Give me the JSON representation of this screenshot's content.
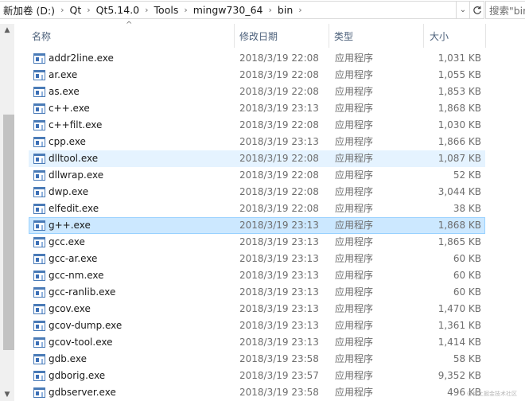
{
  "address": {
    "crumbs": [
      "新加卷 (D:)",
      "Qt",
      "Qt5.14.0",
      "Tools",
      "mingw730_64",
      "bin"
    ],
    "search_placeholder": "搜索\"bin\""
  },
  "columns": {
    "name": "名称",
    "date": "修改日期",
    "type": "类型",
    "size": "大小"
  },
  "files": [
    {
      "name": "addr2line.exe",
      "date": "2018/3/19 22:08",
      "type": "应用程序",
      "size": "1,031 KB"
    },
    {
      "name": "ar.exe",
      "date": "2018/3/19 22:08",
      "type": "应用程序",
      "size": "1,055 KB"
    },
    {
      "name": "as.exe",
      "date": "2018/3/19 22:08",
      "type": "应用程序",
      "size": "1,853 KB"
    },
    {
      "name": "c++.exe",
      "date": "2018/3/19 23:13",
      "type": "应用程序",
      "size": "1,868 KB"
    },
    {
      "name": "c++filt.exe",
      "date": "2018/3/19 22:08",
      "type": "应用程序",
      "size": "1,030 KB"
    },
    {
      "name": "cpp.exe",
      "date": "2018/3/19 23:13",
      "type": "应用程序",
      "size": "1,866 KB"
    },
    {
      "name": "dlltool.exe",
      "date": "2018/3/19 22:08",
      "type": "应用程序",
      "size": "1,087 KB"
    },
    {
      "name": "dllwrap.exe",
      "date": "2018/3/19 22:08",
      "type": "应用程序",
      "size": "52 KB"
    },
    {
      "name": "dwp.exe",
      "date": "2018/3/19 22:08",
      "type": "应用程序",
      "size": "3,044 KB"
    },
    {
      "name": "elfedit.exe",
      "date": "2018/3/19 22:08",
      "type": "应用程序",
      "size": "38 KB"
    },
    {
      "name": "g++.exe",
      "date": "2018/3/19 23:13",
      "type": "应用程序",
      "size": "1,868 KB"
    },
    {
      "name": "gcc.exe",
      "date": "2018/3/19 23:13",
      "type": "应用程序",
      "size": "1,865 KB"
    },
    {
      "name": "gcc-ar.exe",
      "date": "2018/3/19 23:13",
      "type": "应用程序",
      "size": "60 KB"
    },
    {
      "name": "gcc-nm.exe",
      "date": "2018/3/19 23:13",
      "type": "应用程序",
      "size": "60 KB"
    },
    {
      "name": "gcc-ranlib.exe",
      "date": "2018/3/19 23:13",
      "type": "应用程序",
      "size": "60 KB"
    },
    {
      "name": "gcov.exe",
      "date": "2018/3/19 23:13",
      "type": "应用程序",
      "size": "1,470 KB"
    },
    {
      "name": "gcov-dump.exe",
      "date": "2018/3/19 23:13",
      "type": "应用程序",
      "size": "1,361 KB"
    },
    {
      "name": "gcov-tool.exe",
      "date": "2018/3/19 23:13",
      "type": "应用程序",
      "size": "1,414 KB"
    },
    {
      "name": "gdb.exe",
      "date": "2018/3/19 23:58",
      "type": "应用程序",
      "size": "58 KB"
    },
    {
      "name": "gdborig.exe",
      "date": "2018/3/19 23:57",
      "type": "应用程序",
      "size": "9,352 KB"
    },
    {
      "name": "gdbserver.exe",
      "date": "2018/3/19 23:58",
      "type": "应用程序",
      "size": "496 KB"
    }
  ],
  "hover_index": 6,
  "selected_index": 10,
  "watermark": "@稀土掘金技术社区",
  "colors": {
    "selected_bg": "#cce8ff",
    "selected_border": "#99d1ff",
    "hover_bg": "#e5f3ff",
    "header_text": "#4c607a"
  }
}
